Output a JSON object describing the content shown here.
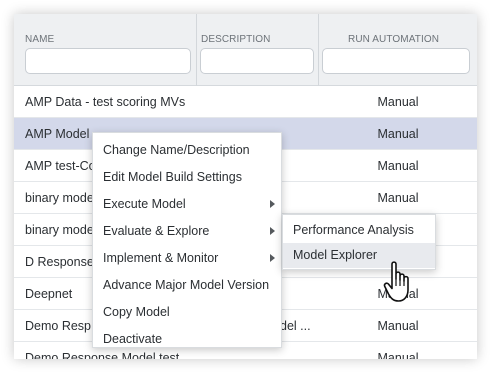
{
  "table": {
    "columns": {
      "name": "NAME",
      "description": "DESCRIPTION",
      "run_automation": "RUN AUTOMATION"
    },
    "filters": {
      "name": "",
      "description": "",
      "run_automation": ""
    },
    "rows": [
      {
        "name": "AMP Data - test scoring MVs",
        "description": "",
        "run": "Manual"
      },
      {
        "name": "AMP Model",
        "description": "",
        "run": "Manual"
      },
      {
        "name": "AMP test-Co",
        "description": "",
        "run": "Manual"
      },
      {
        "name": "binary mode",
        "description": "",
        "run": "Manual"
      },
      {
        "name": "binary mode",
        "description": "",
        "run": ""
      },
      {
        "name": "D Response",
        "description": "",
        "run": ""
      },
      {
        "name": "Deepnet",
        "description": "",
        "run": "Manual"
      },
      {
        "name": "Demo Resp",
        "description": "del ...",
        "run": "Manual"
      },
      {
        "name": "Demo Response Model test",
        "description": "",
        "run": "Manual"
      }
    ]
  },
  "context_menu": {
    "items": [
      {
        "label": "Change Name/Description",
        "submenu": false
      },
      {
        "label": "Edit Model Build Settings",
        "submenu": false
      },
      {
        "label": "Execute Model",
        "submenu": true
      },
      {
        "label": "Evaluate & Explore",
        "submenu": true
      },
      {
        "label": "Implement & Monitor",
        "submenu": true
      },
      {
        "label": "Advance Major Model Version",
        "submenu": false
      },
      {
        "label": "Copy Model",
        "submenu": false
      },
      {
        "label": "Deactivate",
        "submenu": false
      }
    ]
  },
  "submenu": {
    "items": [
      {
        "label": "Performance Analysis"
      },
      {
        "label": "Model Explorer"
      }
    ]
  },
  "colors": {
    "selected_row": "#d3d8ea",
    "header_bg": "#eef0f2",
    "menu_hover": "#e8eaee"
  },
  "icons": {
    "cursor": "hand-pointer-icon",
    "submenu_arrow": "caret-right-icon"
  }
}
